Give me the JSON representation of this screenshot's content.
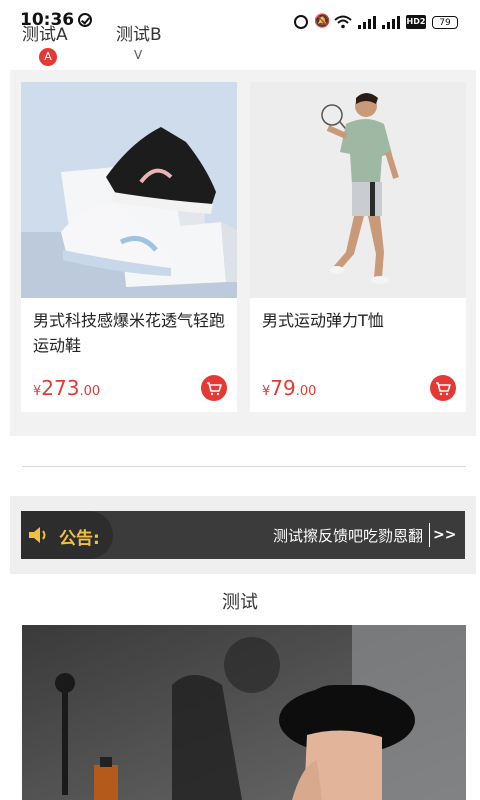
{
  "status_bar": {
    "time": "10:36",
    "battery": "79",
    "hd_label": "HD2",
    "icons": [
      "check-circle-icon",
      "alarm-icon",
      "mute-icon",
      "wifi-icon",
      "signal-4g-icon",
      "signal-4g-icon",
      "hd-icon",
      "battery-icon"
    ]
  },
  "tabs": [
    {
      "label": "测试A",
      "badge": "A"
    },
    {
      "label": "测试B",
      "indicator": "V"
    }
  ],
  "products": [
    {
      "name": "男式科技感爆米花透气轻跑运动鞋",
      "currency": "¥",
      "price_int": "273",
      "price_dec": ".00"
    },
    {
      "name": "男式运动弹力T恤",
      "currency": "¥",
      "price_int": "79",
      "price_dec": ".00"
    }
  ],
  "notice": {
    "label": "公告:",
    "text": "测试擦反馈吧吃勠恩翻",
    "more": ">>"
  },
  "section": {
    "title": "测试"
  },
  "colors": {
    "accent": "#e53935",
    "notice_bg": "#3b3b3b",
    "notice_label": "#f0c040",
    "page_bg": "#f2f2f2"
  }
}
